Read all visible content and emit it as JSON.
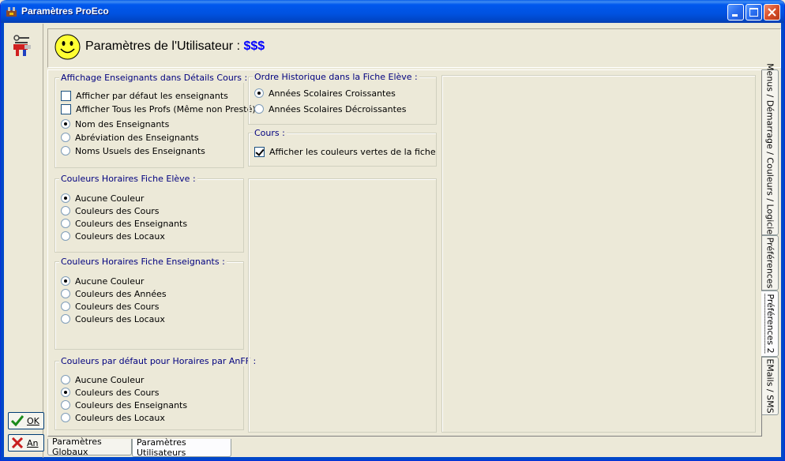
{
  "window": {
    "title": "Paramètres ProEco",
    "controls": [
      "minimize",
      "maximize",
      "close"
    ]
  },
  "header": {
    "title": "Paramètres de l'Utilisateur : ",
    "value": "$$$"
  },
  "side_buttons": {
    "ok_label": "OK",
    "cancel_label": "An"
  },
  "groups": {
    "affichage": {
      "title": "Affichage Enseignants dans Détails Cours :",
      "checkboxes": [
        {
          "label": "Afficher par défaut les enseignants",
          "checked": false
        },
        {
          "label": "Afficher Tous les Profs (Même non Presté)",
          "checked": false
        }
      ],
      "radios": [
        {
          "label": "Nom des Enseignants",
          "selected": true
        },
        {
          "label": "Abréviation des Enseignants",
          "selected": false
        },
        {
          "label": "Noms Usuels des Enseignants",
          "selected": false
        }
      ]
    },
    "couleurs_eleve": {
      "title": "Couleurs Horaires Fiche Elève  :",
      "radios": [
        {
          "label": "Aucune Couleur",
          "selected": true
        },
        {
          "label": "Couleurs des Cours",
          "selected": false
        },
        {
          "label": "Couleurs des Enseignants",
          "selected": false
        },
        {
          "label": "Couleurs des Locaux",
          "selected": false
        }
      ]
    },
    "couleurs_enseignants": {
      "title": "Couleurs Horaires Fiche Enseignants :",
      "radios": [
        {
          "label": "Aucune Couleur",
          "selected": true
        },
        {
          "label": "Couleurs des Années",
          "selected": false
        },
        {
          "label": "Couleurs des Cours",
          "selected": false
        },
        {
          "label": "Couleurs des Locaux",
          "selected": false
        }
      ]
    },
    "couleurs_anff": {
      "title": "Couleurs par défaut pour Horaires par AnFF :",
      "radios": [
        {
          "label": "Aucune Couleur",
          "selected": false
        },
        {
          "label": "Couleurs des Cours",
          "selected": true
        },
        {
          "label": "Couleurs des Enseignants",
          "selected": false
        },
        {
          "label": "Couleurs des Locaux",
          "selected": false
        }
      ]
    },
    "ordre": {
      "title": "Ordre Historique dans la Fiche Elève :",
      "radios": [
        {
          "label": "Années Scolaires Croissantes",
          "selected": true
        },
        {
          "label": "Années Scolaires Décroissantes",
          "selected": false
        }
      ]
    },
    "cours": {
      "title": "Cours :",
      "checkboxes": [
        {
          "label": "Afficher les couleurs vertes de la fiche",
          "checked": true
        }
      ]
    }
  },
  "vertical_tabs": [
    {
      "label": "Menus / Démarrage / Couleurs / Logiciels",
      "active": false
    },
    {
      "label": "Préférences",
      "active": false
    },
    {
      "label": "Préférences 2",
      "active": true
    },
    {
      "label": "EMails / SMS",
      "active": false
    }
  ],
  "bottom_tabs": [
    {
      "label": "Paramètres Globaux",
      "active": false
    },
    {
      "label": "Paramètres Utilisateurs",
      "active": true
    }
  ],
  "colors": {
    "titlebar": "#0052e0",
    "group_title": "#00007f",
    "header_value": "#0000ff",
    "face": "#ece9d8"
  }
}
